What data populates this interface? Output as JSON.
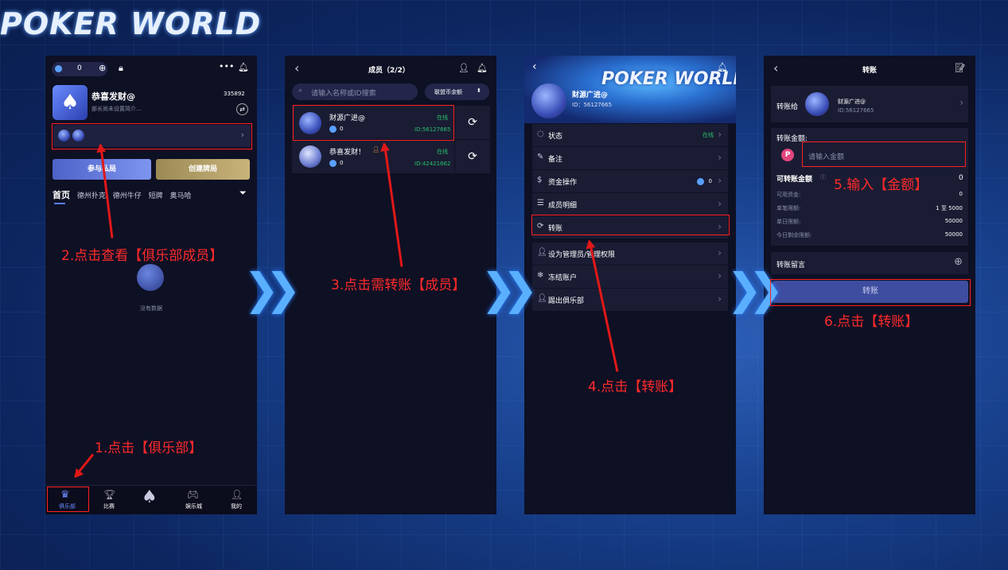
{
  "logo": "POKER WORLD",
  "steps": {
    "s1": "1.点击【俱乐部】",
    "s2": "2.点击查看【俱乐部成员】",
    "s3": "3.点击需转账【成员】",
    "s4": "4.点击【转账】",
    "s5": "5.输入【金额】",
    "s6": "6.点击【转账】"
  },
  "p1": {
    "balance": "0",
    "club_name": "恭喜发财@",
    "club_id": "335892",
    "desc": "部长尚未设置简介...",
    "btn_join": "参与私局",
    "btn_create": "创建牌局",
    "tabs": [
      "首页",
      "德州扑克",
      "德州牛仔",
      "短牌",
      "奥马哈"
    ],
    "empty": "没有数据",
    "nav": [
      "俱乐部",
      "比赛",
      "",
      "娱乐城",
      "我的"
    ]
  },
  "p2": {
    "title": "成员（2/2）",
    "search_placeholder": "请输入名称或ID搜索",
    "filter": "联盟币余额",
    "members": [
      {
        "name": "财源广进@",
        "status": "在线",
        "balance": "0",
        "id": "ID:56127665"
      },
      {
        "name": "恭喜发财！",
        "status": "在线",
        "balance": "0",
        "id": "ID:42421662"
      }
    ]
  },
  "p3": {
    "name": "财源广进@",
    "id": "ID：56127665",
    "banner": "POKER WORLD",
    "rows": [
      {
        "label": "状态",
        "value": "在线"
      },
      {
        "label": "备注",
        "value": ""
      },
      {
        "label": "资金操作",
        "value": "0"
      },
      {
        "label": "成员明细",
        "value": ""
      },
      {
        "label": "转账",
        "value": ""
      },
      {
        "label": "设为管理员/管理权限",
        "value": ""
      },
      {
        "label": "冻结账户",
        "value": ""
      },
      {
        "label": "踢出俱乐部",
        "value": ""
      }
    ]
  },
  "p4": {
    "title": "转账",
    "to_label": "转账给",
    "to_name": "财源广进@",
    "to_id": "ID:56127665",
    "amount_label": "转账金额:",
    "amount_placeholder": "请输入金额",
    "avail_label": "可转账金额",
    "avail_value": "0",
    "details": [
      {
        "k": "可用资金:",
        "v": "0"
      },
      {
        "k": "单笔限额:",
        "v": "1 至 5000"
      },
      {
        "k": "单日限额:",
        "v": "50000"
      },
      {
        "k": "今日剩余限额:",
        "v": "50000"
      }
    ],
    "note_label": "转账留言",
    "submit": "转账"
  }
}
